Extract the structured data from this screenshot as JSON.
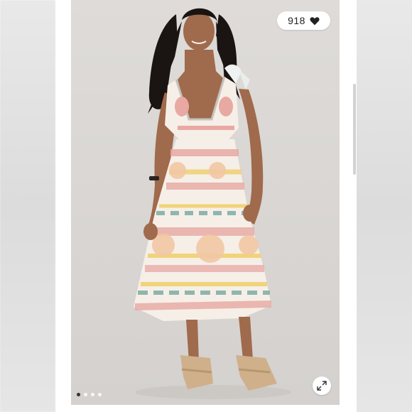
{
  "listing": {
    "likes": {
      "count": "918",
      "icon": "heart-icon"
    },
    "expand": {
      "icon": "expand-arrows-icon"
    },
    "carousel": {
      "total": 4,
      "active_index": 0
    },
    "colors": {
      "backdrop": "#dcdad8",
      "dress_base": "#f6efe8",
      "pink_motif": "#e8a9a3",
      "yellow_motif": "#f0d37a",
      "teal_leaf": "#8fb6ae",
      "skin": "#a06a4d",
      "hair": "#1a1412",
      "sandal": "#cfb08b"
    }
  }
}
